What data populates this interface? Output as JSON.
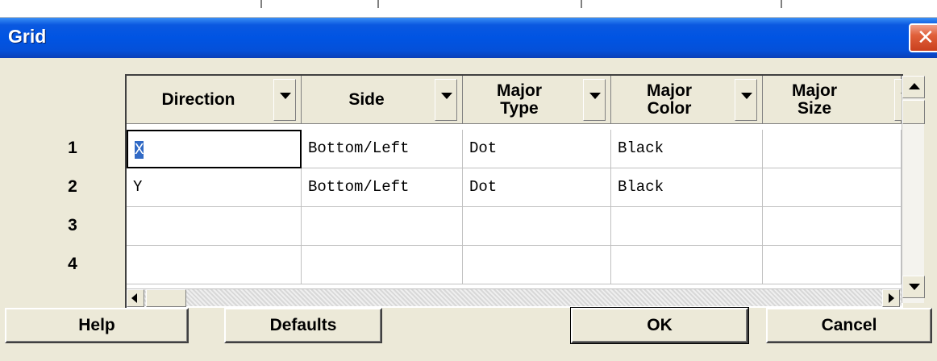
{
  "window": {
    "title": "Grid",
    "close_glyph": "✕"
  },
  "grid": {
    "columns": [
      {
        "label": "Direction"
      },
      {
        "label": "Side"
      },
      {
        "label": "Major Type"
      },
      {
        "label": "Major Color"
      },
      {
        "label": "Major Size"
      }
    ],
    "row_numbers": [
      "1",
      "2",
      "3",
      "4"
    ],
    "rows": [
      [
        "X",
        "Bottom/Left",
        "Dot",
        "Black",
        ""
      ],
      [
        "Y",
        "Bottom/Left",
        "Dot",
        "Black",
        ""
      ],
      [
        "",
        "",
        "",
        "",
        ""
      ],
      [
        "",
        "",
        "",
        "",
        ""
      ]
    ]
  },
  "buttons": {
    "help": "Help",
    "defaults": "Defaults",
    "ok": "OK",
    "cancel": "Cancel"
  }
}
